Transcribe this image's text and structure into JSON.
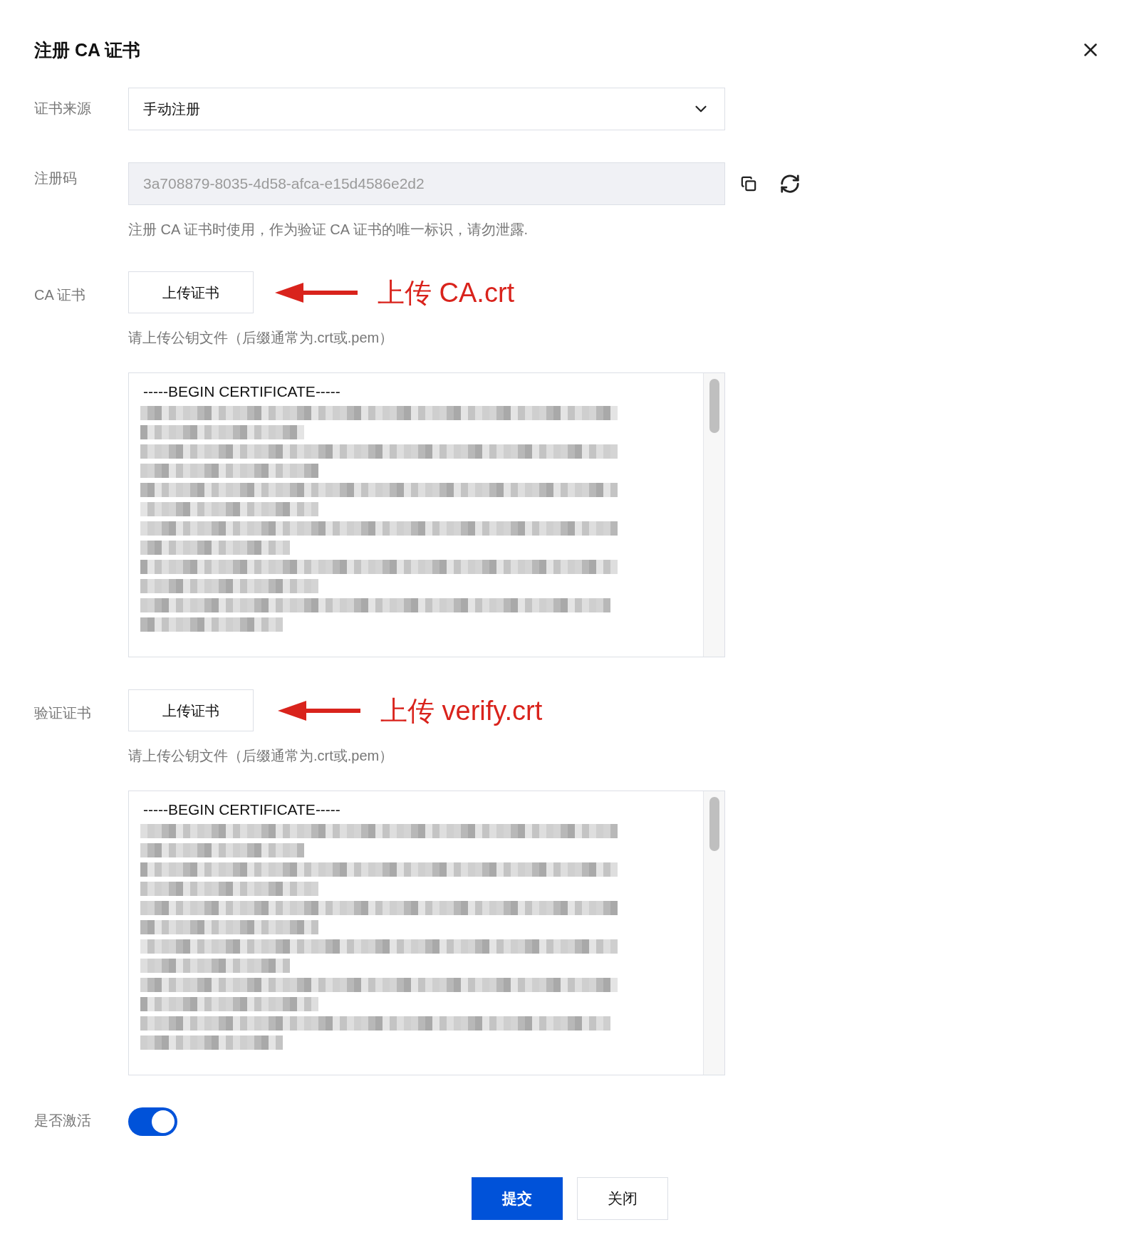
{
  "dialog": {
    "title": "注册 CA 证书"
  },
  "source": {
    "label": "证书来源",
    "value": "手动注册"
  },
  "registration_code": {
    "label": "注册码",
    "value": "3a708879-8035-4d58-afca-e15d4586e2d2",
    "hint": "注册 CA 证书时使用，作为验证 CA 证书的唯一标识，请勿泄露."
  },
  "uploads": [
    {
      "label": "CA 证书",
      "button": "上传证书",
      "annotation": "上传 CA.crt",
      "hint": "请上传公钥文件（后缀通常为.crt或.pem）",
      "first_line": "-----BEGIN CERTIFICATE-----"
    },
    {
      "label": "验证证书",
      "button": "上传证书",
      "annotation": "上传 verify.crt",
      "hint": "请上传公钥文件（后缀通常为.crt或.pem）",
      "first_line": "-----BEGIN CERTIFICATE-----"
    }
  ],
  "activate": {
    "label": "是否激活",
    "on": true
  },
  "buttons": [
    {
      "label": "提交",
      "kind": "primary"
    },
    {
      "label": "关闭",
      "kind": "default"
    }
  ]
}
